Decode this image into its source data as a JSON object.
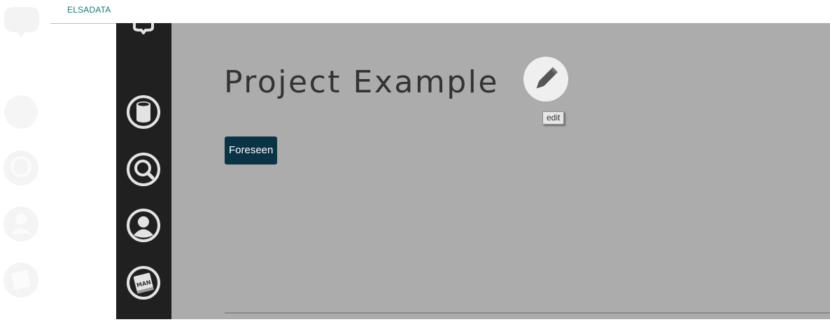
{
  "header": {
    "brand": "ELSADATA"
  },
  "page": {
    "title": "Project Example",
    "edit_tooltip": "edit",
    "tags": [
      "Foreseen"
    ]
  },
  "sidebar": {
    "items": [
      {
        "icon": "database-icon"
      },
      {
        "icon": "search-icon"
      },
      {
        "icon": "user-icon"
      },
      {
        "icon": "manual-icon",
        "label": "MAN"
      }
    ]
  },
  "colors": {
    "brand": "#117d76",
    "sidebar_bg": "#202020",
    "main_bg": "#acacac",
    "tag_bg": "#0a3345"
  }
}
